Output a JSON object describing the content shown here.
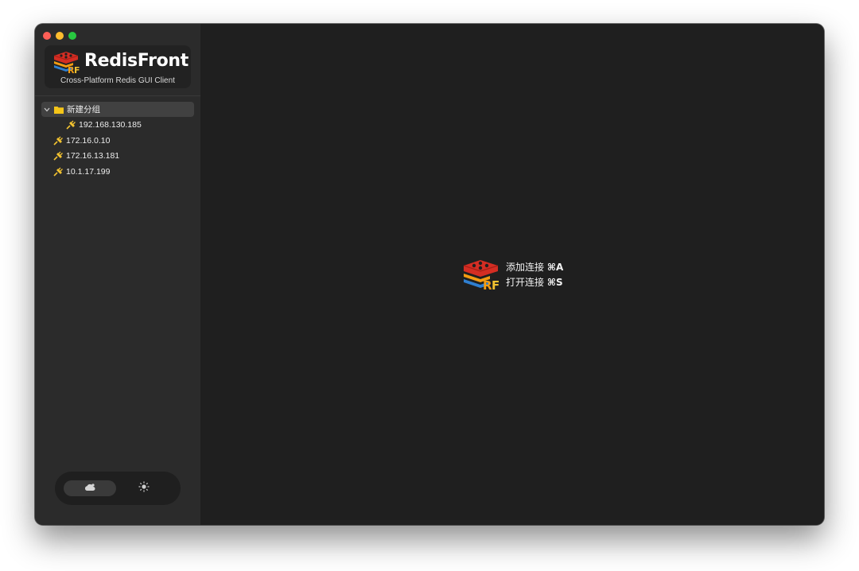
{
  "app": {
    "name": "RedisFront",
    "tagline": "Cross-Platform Redis GUI Client"
  },
  "sidebar": {
    "group": {
      "label": "新建分组",
      "expanded": true,
      "children": [
        {
          "label": "192.168.130.185"
        }
      ]
    },
    "connections": [
      {
        "label": "172.16.0.10"
      },
      {
        "label": "172.16.13.181"
      },
      {
        "label": "10.1.17.199"
      }
    ],
    "theme_toggle": {
      "selected": "dark",
      "options": [
        "dark",
        "light"
      ]
    }
  },
  "main": {
    "welcome": {
      "actions": [
        {
          "label": "添加连接",
          "shortcut": "⌘A"
        },
        {
          "label": "打开连接",
          "shortcut": "⌘S"
        }
      ]
    }
  },
  "colors": {
    "sidebar_bg": "#2b2b2b",
    "main_bg": "#1f1f1f",
    "folder": "#f5c518",
    "plug": "#f2c230",
    "logo_red": "#d42d23",
    "logo_orange": "#f39c12",
    "logo_blue": "#2f7fd0"
  }
}
